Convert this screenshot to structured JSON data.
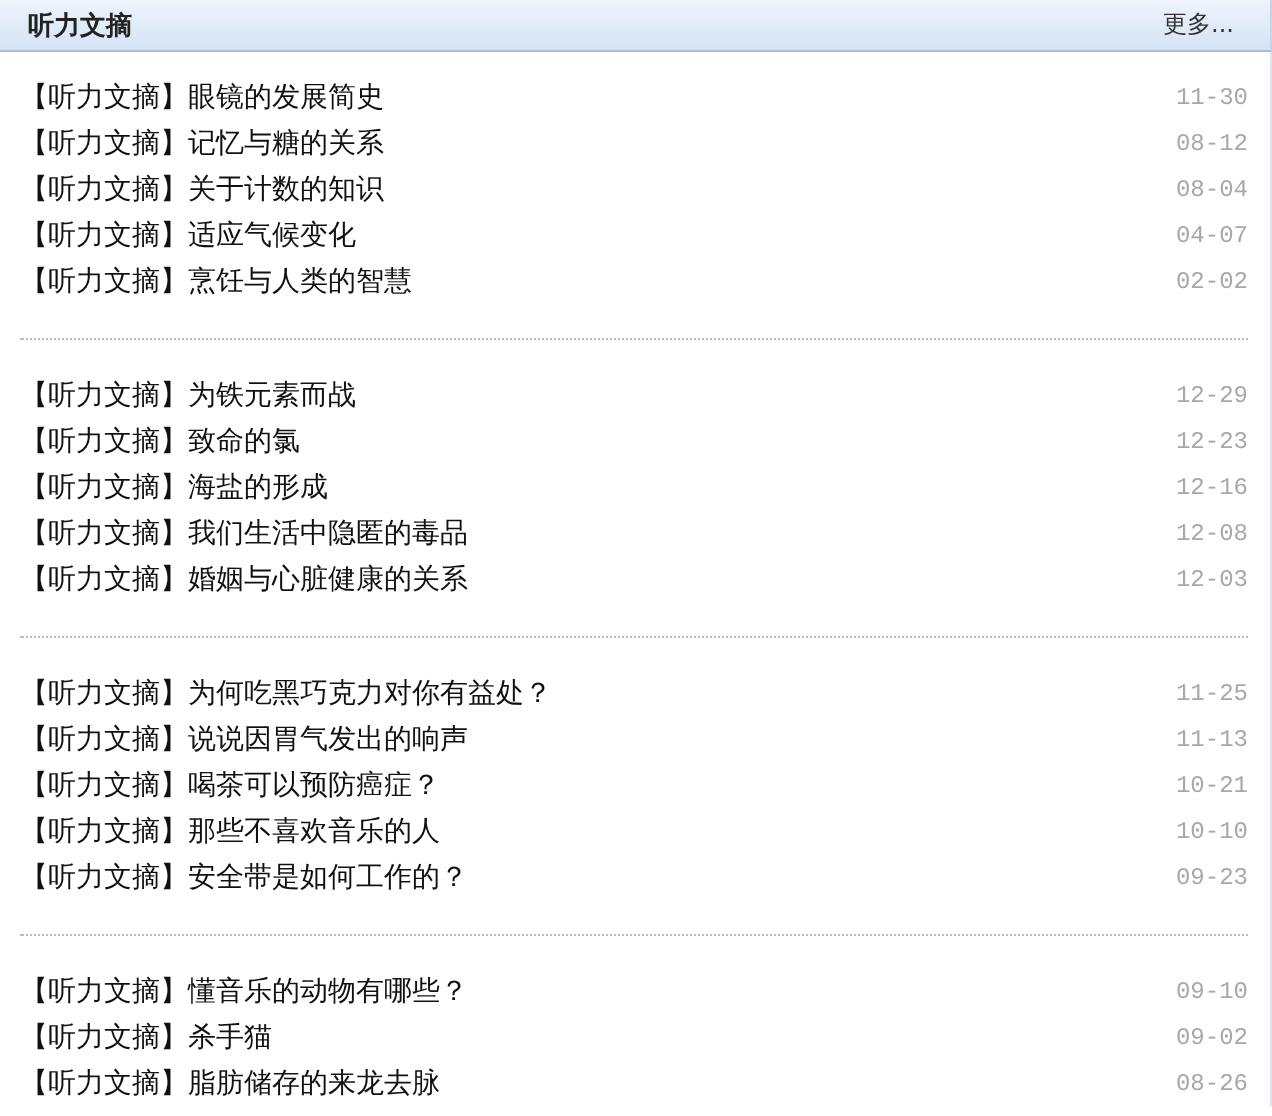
{
  "panel": {
    "title": "听力文摘",
    "more_link": "更多..."
  },
  "groups": [
    {
      "items": [
        {
          "title": "【听力文摘】眼镜的发展简史",
          "date": "11-30"
        },
        {
          "title": "【听力文摘】记忆与糖的关系",
          "date": "08-12"
        },
        {
          "title": "【听力文摘】关于计数的知识",
          "date": "08-04"
        },
        {
          "title": "【听力文摘】适应气候变化",
          "date": "04-07"
        },
        {
          "title": "【听力文摘】烹饪与人类的智慧",
          "date": "02-02"
        }
      ]
    },
    {
      "items": [
        {
          "title": "【听力文摘】为铁元素而战",
          "date": "12-29"
        },
        {
          "title": "【听力文摘】致命的氯",
          "date": "12-23"
        },
        {
          "title": "【听力文摘】海盐的形成",
          "date": "12-16"
        },
        {
          "title": "【听力文摘】我们生活中隐匿的毒品",
          "date": "12-08"
        },
        {
          "title": "【听力文摘】婚姻与心脏健康的关系",
          "date": "12-03"
        }
      ]
    },
    {
      "items": [
        {
          "title": "【听力文摘】为何吃黑巧克力对你有益处？",
          "date": "11-25"
        },
        {
          "title": "【听力文摘】说说因胃气发出的响声",
          "date": "11-13"
        },
        {
          "title": "【听力文摘】喝茶可以预防癌症？",
          "date": "10-21"
        },
        {
          "title": "【听力文摘】那些不喜欢音乐的人",
          "date": "10-10"
        },
        {
          "title": "【听力文摘】安全带是如何工作的？",
          "date": "09-23"
        }
      ]
    },
    {
      "items": [
        {
          "title": "【听力文摘】懂音乐的动物有哪些？",
          "date": "09-10"
        },
        {
          "title": "【听力文摘】杀手猫",
          "date": "09-02"
        },
        {
          "title": "【听力文摘】脂肪储存的来龙去脉",
          "date": "08-26"
        }
      ]
    }
  ]
}
